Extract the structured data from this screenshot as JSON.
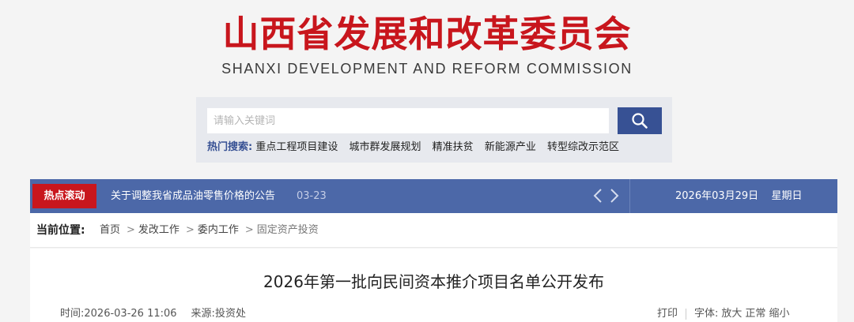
{
  "header": {
    "title_cn": "山西省发展和改革委员会",
    "title_en": "SHANXI DEVELOPMENT AND REFORM COMMISSION"
  },
  "search": {
    "placeholder": "请输入关键词",
    "button_icon": "search-icon",
    "hot_label": "热门搜索:",
    "hot_items": [
      "重点工程项目建设",
      "城市群发展规划",
      "精准扶贫",
      "新能源产业",
      "转型综改示范区"
    ]
  },
  "ticker": {
    "label": "热点滚动",
    "news_title": "关于调整我省成品油零售价格的公告",
    "news_date": "03-23",
    "prev_icon": "chevron-left-icon",
    "next_icon": "chevron-right-icon",
    "current_date": "2026年03月29日",
    "weekday": "星期日"
  },
  "breadcrumb": {
    "label": "当前位置:",
    "items": [
      "首页",
      "发改工作",
      "委内工作",
      "固定资产投资"
    ]
  },
  "article": {
    "title": "2026年第一批向民间资本推介项目名单公开发布",
    "time_label": "时间:",
    "time_value": "2026-03-26 11:06",
    "source_label": "来源:",
    "source_value": "投资处",
    "print_label": "打印",
    "font_label": "字体:",
    "font_large": "放大",
    "font_normal": "正常",
    "font_small": "缩小"
  },
  "colors": {
    "brand_red": "#c8161d",
    "nav_blue": "#4c68a8",
    "button_blue": "#375194"
  }
}
